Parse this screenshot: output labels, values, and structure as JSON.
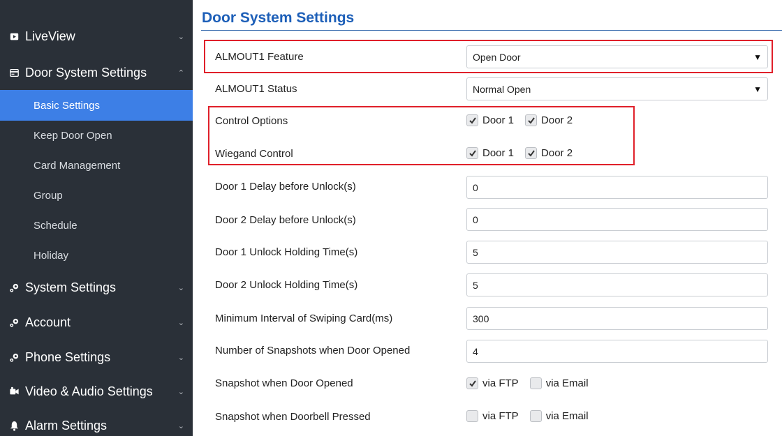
{
  "sidebar": {
    "liveview": "LiveView",
    "door_system": "Door System Settings",
    "sub_items": [
      "Basic Settings",
      "Keep Door Open",
      "Card Management",
      "Group",
      "Schedule",
      "Holiday"
    ],
    "system_settings": "System Settings",
    "account": "Account",
    "phone_settings": "Phone Settings",
    "video_audio": "Video & Audio Settings",
    "alarm_settings": "Alarm Settings",
    "active_color": "#3d7fe6"
  },
  "page": {
    "title": "Door System Settings"
  },
  "settings": {
    "almout1_feature": {
      "label": "ALMOUT1 Feature",
      "value": "Open Door"
    },
    "almout1_status": {
      "label": "ALMOUT1 Status",
      "value": "Normal Open"
    },
    "control_options": {
      "label": "Control Options",
      "door1": "Door 1",
      "door2": "Door 2",
      "door1_checked": true,
      "door2_checked": true
    },
    "wiegand_control": {
      "label": "Wiegand Control",
      "door1": "Door 1",
      "door2": "Door 2",
      "door1_checked": true,
      "door2_checked": true
    },
    "door1_delay": {
      "label": "Door 1 Delay before Unlock(s)",
      "value": "0"
    },
    "door2_delay": {
      "label": "Door 2 Delay before Unlock(s)",
      "value": "0"
    },
    "door1_hold": {
      "label": "Door 1 Unlock Holding Time(s)",
      "value": "5"
    },
    "door2_hold": {
      "label": "Door 2 Unlock Holding Time(s)",
      "value": "5"
    },
    "min_interval": {
      "label": "Minimum Interval of Swiping Card(ms)",
      "value": "300"
    },
    "num_snapshots": {
      "label": "Number of Snapshots when Door Opened",
      "value": "4"
    },
    "snapshot_opened": {
      "label": "Snapshot when Door Opened",
      "ftp": "via FTP",
      "email": "via Email",
      "ftp_checked": true,
      "email_checked": false
    },
    "snapshot_doorbell": {
      "label": "Snapshot when Doorbell Pressed",
      "ftp": "via FTP",
      "email": "via Email",
      "ftp_checked": false,
      "email_checked": false
    }
  },
  "highlight_color": "#e0202a"
}
